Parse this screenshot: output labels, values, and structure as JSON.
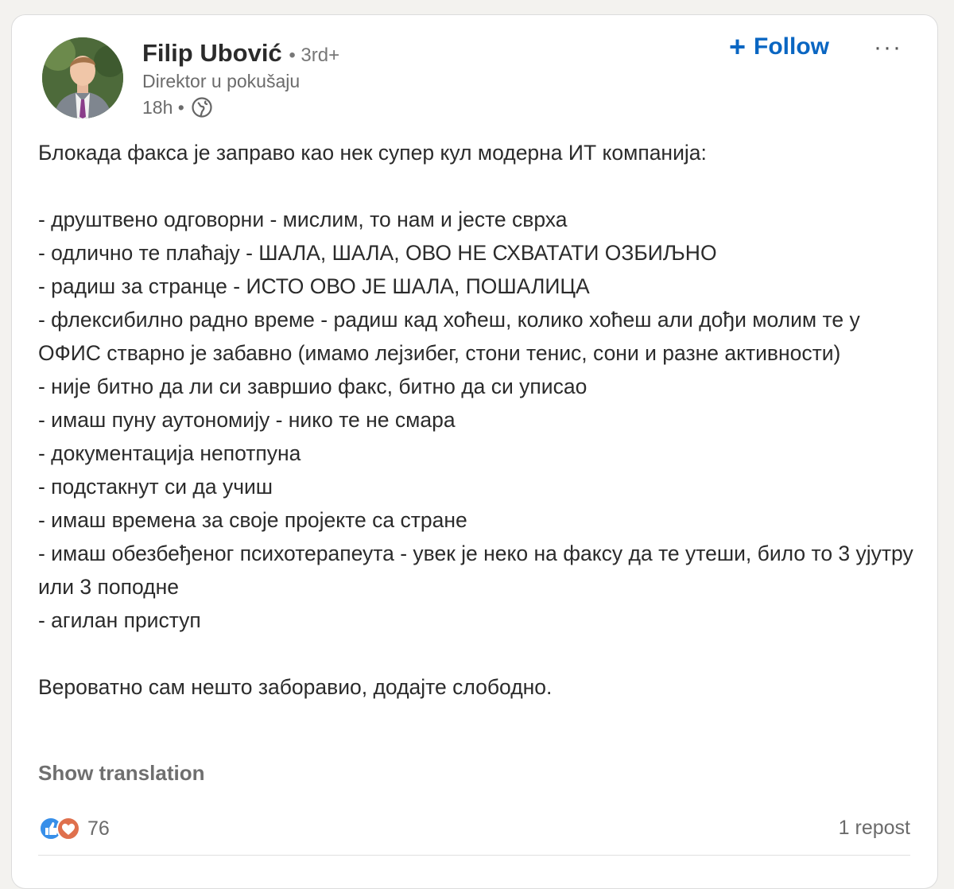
{
  "author": {
    "name": "Filip Ubović",
    "degree": "• 3rd+",
    "headline": "Direktor u pokušaju",
    "time": "18h •"
  },
  "actions": {
    "follow_label": "Follow",
    "more_label": "···"
  },
  "post": {
    "intro": "Блокада факса је заправо као нек супер кул модерна ИТ компанија:",
    "items": [
      "- друштвено одговорни - мислим, то нам и јесте сврха",
      "- одлично те плаћају - ШАЛА, ШАЛА, ОВО НЕ СХВАТАТИ ОЗБИЉНО",
      "- радиш за странце - ИСТО ОВО ЈЕ ШАЛА, ПОШАЛИЦА",
      "- флексибилно радно време - радиш кад хоћеш, колико хоћеш али дођи молим те у ОФИС стварно је забавно (имамо лејзибег, стони тенис, сони и разне активности)",
      "- није битно да ли си завршио факс, битно да си уписао",
      "- имаш пуну аутономију - нико те не смара",
      "- документација непотпуна",
      "- подстакнут си да учиш",
      "- имаш времена за своје пројекте са стране",
      "- имаш обезбеђеног психотерапеута - увек је неко на факсу да те утеши, било то 3 ујутру или 3 поподне",
      "- агилан приступ"
    ],
    "outro": "Вероватно сам нешто заборавио, додајте слободно.",
    "show_translation": "Show translation"
  },
  "social": {
    "reaction_count": "76",
    "repost_count": "1 repost",
    "reaction_icons": [
      "like-icon",
      "love-icon"
    ]
  },
  "colors": {
    "accent": "#0a66c2",
    "like": "#378fe9",
    "love": "#df704d"
  }
}
